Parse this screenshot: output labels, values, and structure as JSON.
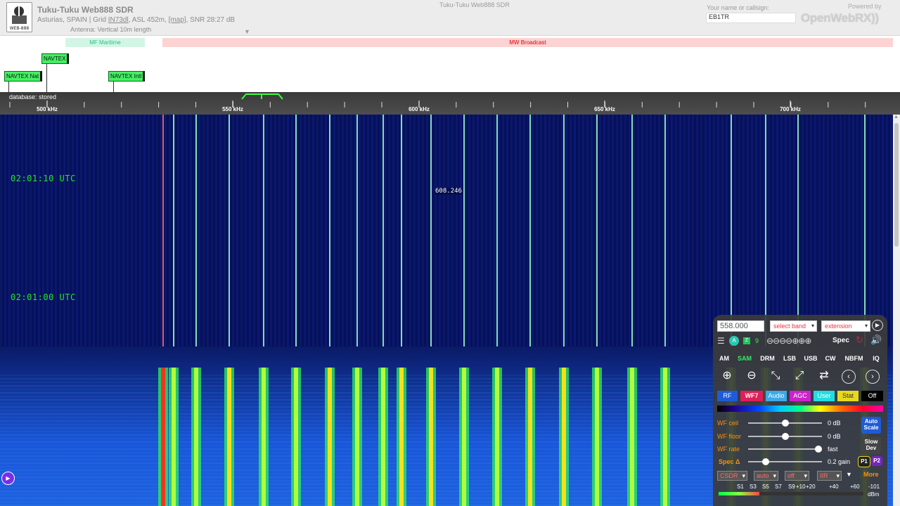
{
  "header": {
    "title": "Tuku-Tuku Web888 SDR",
    "logo_text": "WEB-888",
    "location_prefix": "Asturias, SPAIN | Grid",
    "grid": "IN73dl",
    "asl": ", ASL 452m,",
    "map_link": "[map]",
    "snr": ", SNR 28:27 dB",
    "antenna": "Antenna: Vertical 10m length",
    "center_title": "Tuku-Tuku Web888 SDR",
    "callsign_label": "Your name or callsign:",
    "callsign_value": "EB1TR",
    "powered_by": "Powered by",
    "brand": "OpenWebRX"
  },
  "bands": {
    "mf": "MF Maritime",
    "mw": "MW Broadcast"
  },
  "bookmarks": [
    "NAVTEX",
    "NAVTEX Nat",
    "NAVTEX Intl"
  ],
  "scale": {
    "database": "database: stored",
    "labels": [
      "500 kHz",
      "550 kHz",
      "600 kHz",
      "650 kHz",
      "700 kHz"
    ]
  },
  "waterfall": {
    "utc1": "02:01:10 UTC",
    "utc2": "02:01:00 UTC",
    "marker": "608.246"
  },
  "panel": {
    "frequency": "558.000",
    "band_select": "select band",
    "extension_select": "extension",
    "spec_label": "Spec",
    "modes": [
      "AM",
      "SAM",
      "DRM",
      "LSB",
      "USB",
      "CW",
      "NBFM",
      "IQ"
    ],
    "tabs": [
      "RF",
      "WF7",
      "Audio",
      "AGC",
      "User",
      "Stat",
      "Off"
    ],
    "wf_ceil_label": "WF ceil",
    "wf_ceil_val": "0 dB",
    "wf_floor_label": "WF floor",
    "wf_floor_val": "0 dB",
    "wf_rate_label": "WF rate",
    "wf_rate_val": "fast",
    "spec_delta_label": "Spec Δ",
    "spec_delta_val": "0.2 gain",
    "auto_scale_1": "Auto",
    "auto_scale_2": "Scale",
    "slow_dev_1": "Slow",
    "slow_dev_2": "Dev",
    "p1": "P1",
    "p2": "P2",
    "dd1": "CSDR",
    "dd2": "auto",
    "dd3": "off",
    "dd4": "IIR",
    "more": "More",
    "smeter_labels": [
      "S1",
      "S3",
      "S5",
      "S7",
      "S9",
      "+10",
      "+20",
      "+40",
      "+60",
      "-101"
    ],
    "dbm": "dBm",
    "row2_num": "9"
  },
  "colors": {
    "accent_green": "#44ef63",
    "utc_green": "#22e522",
    "panel_orange": "#ff9200"
  }
}
